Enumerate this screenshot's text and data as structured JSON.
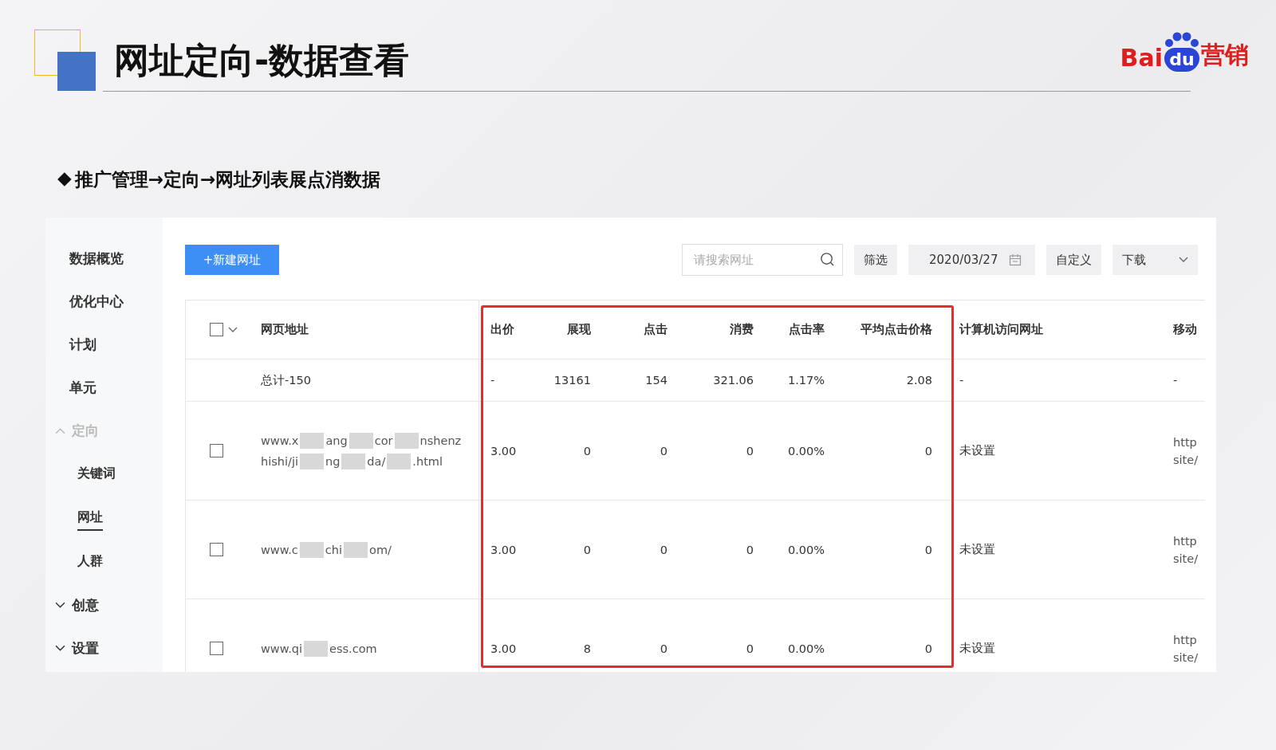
{
  "slide": {
    "title": "网址定向-数据查看",
    "logo": {
      "text_left": "Bai",
      "text_badge": "du",
      "text_right": "营销"
    },
    "subtitle_marker": "◆",
    "subtitle": "推广管理→定向→网址列表展点消数据"
  },
  "sidebar": {
    "items": [
      {
        "label": "数据概览",
        "selected": false
      },
      {
        "label": "优化中心",
        "selected": false
      },
      {
        "label": "计划",
        "selected": false
      },
      {
        "label": "单元",
        "selected": false
      },
      {
        "label": "定向",
        "selected": false,
        "expanded": true,
        "children": [
          {
            "label": "关键词",
            "selected": false
          },
          {
            "label": "网址",
            "selected": true
          },
          {
            "label": "人群",
            "selected": false
          }
        ]
      },
      {
        "label": "创意",
        "selected": false,
        "expanded": false
      },
      {
        "label": "设置",
        "selected": false,
        "expanded": false
      }
    ]
  },
  "toolbar": {
    "new_button": "+新建网址",
    "search": {
      "placeholder": "请搜索网址"
    },
    "filter_button": "筛选",
    "date": "2020/03/27",
    "customize_button": "自定义",
    "download_button": "下载"
  },
  "table": {
    "header_checked": false,
    "columns": [
      "网页地址",
      "出价",
      "展现",
      "点击",
      "消费",
      "点击率",
      "平均点击价格",
      "计算机访问网址",
      "移动"
    ],
    "summary": [
      "总计-150",
      "-",
      "13161",
      "154",
      "321.06",
      "1.17%",
      "2.08",
      "-",
      "-"
    ],
    "rows": [
      {
        "checked": false,
        "cells": [
          [
            [
              "www.x",
              "ang",
              "cor",
              "nshenz"
            ],
            [
              "hishi/ji",
              "ng",
              "da/",
              ".html"
            ]
          ],
          "3.00",
          "0",
          "0",
          "0",
          "0.00%",
          "0",
          "未设置",
          [
            "http",
            "site/"
          ]
        ]
      },
      {
        "checked": false,
        "cells": [
          [
            [
              "www.c",
              "chi",
              "om/"
            ]
          ],
          "3.00",
          "0",
          "0",
          "0",
          "0.00%",
          "0",
          "未设置",
          [
            "http",
            "site/"
          ]
        ]
      },
      {
        "checked": false,
        "cells": [
          [
            [
              "www.qi",
              "ess.com"
            ]
          ],
          "3.00",
          "8",
          "0",
          "0",
          "0.00%",
          "0",
          "未设置",
          [
            "http",
            "site/"
          ]
        ]
      }
    ]
  }
}
